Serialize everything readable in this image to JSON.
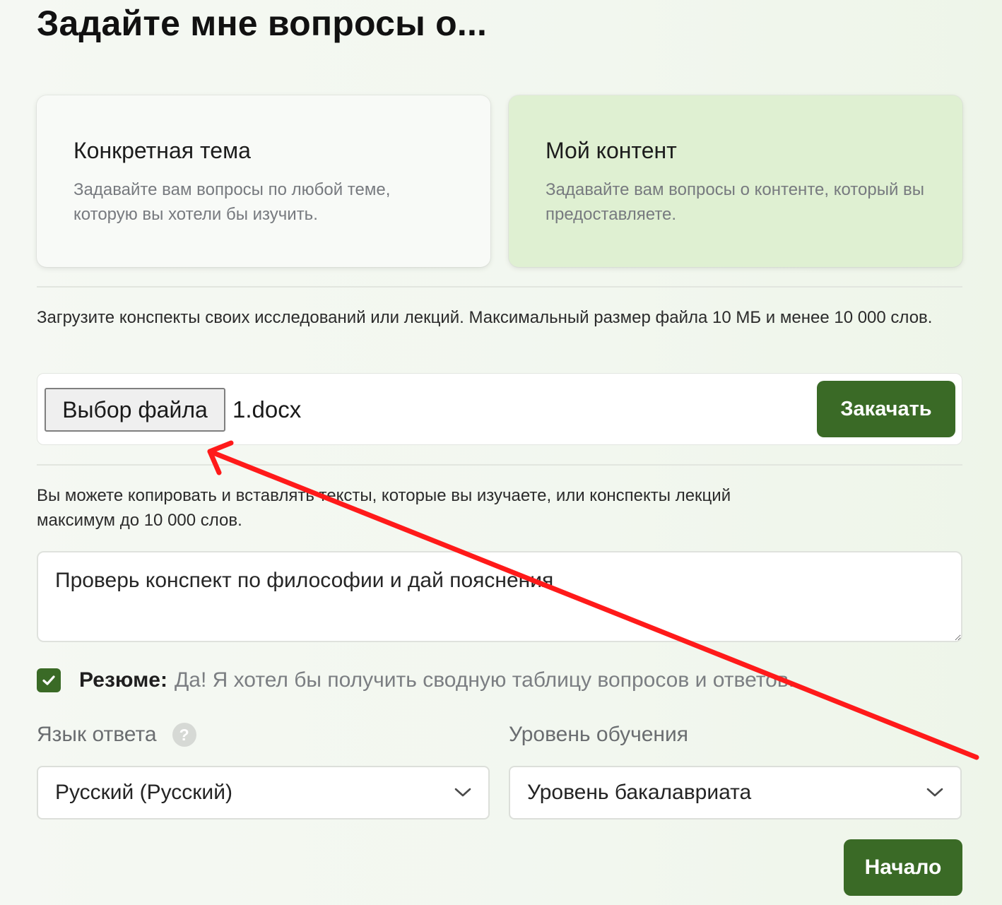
{
  "page": {
    "title": "Задайте мне вопросы о..."
  },
  "cards": {
    "topic": {
      "title": "Конкретная тема",
      "description": "Задавайте вам вопросы по любой теме, которую вы хотели бы изучить.",
      "selected": false
    },
    "content": {
      "title": "Мой контент",
      "description": "Задавайте вам вопросы о контенте, который вы предоставляете.",
      "selected": true
    }
  },
  "upload": {
    "instructions": "Загрузите конспекты своих исследований или лекций. Максимальный размер файла 10 МБ и менее 10 000 слов.",
    "choose_file_label": "Выбор файла",
    "file_name": "1.docx",
    "upload_button": "Закачать"
  },
  "paste": {
    "instructions": "Вы можете копировать и вставлять тексты, которые вы изучаете, или конспекты лекций максимум до 10 000 слов.",
    "value": "Проверь конспект по философии и дай пояснения"
  },
  "summary": {
    "checked": true,
    "label": "Резюме:",
    "text": "Да! Я хотел бы получить сводную таблицу вопросов и ответов."
  },
  "language": {
    "label": "Язык ответа",
    "help_icon": "?",
    "selected": "Русский (Русский)"
  },
  "level": {
    "label": "Уровень обучения",
    "selected": "Уровень бакалавриата"
  },
  "start_button": "Начало",
  "colors": {
    "accent": "#3a6a26",
    "selected_card": "#dff0d2",
    "annotation_arrow": "#ff1a1a"
  },
  "icons": {
    "checkbox": "check-icon",
    "select": "chevron-down-icon",
    "textarea": "resize-handle-icon",
    "help": "question-icon"
  }
}
